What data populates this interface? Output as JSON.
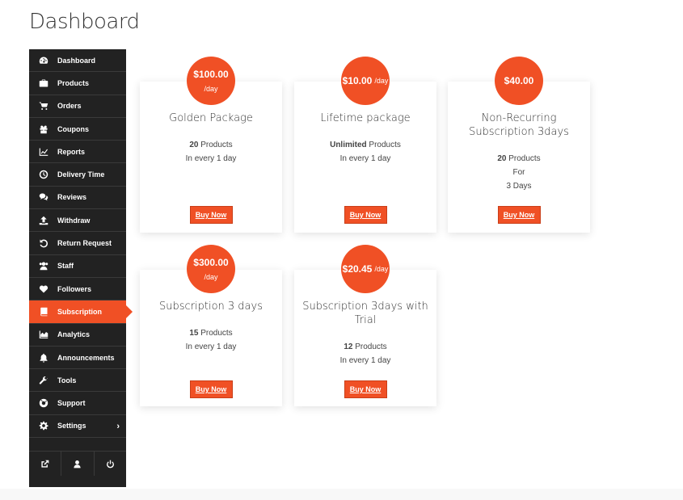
{
  "page": {
    "title": "Dashboard"
  },
  "sidebar": {
    "items": [
      {
        "label": "Dashboard",
        "icon": "dashboard-icon"
      },
      {
        "label": "Products",
        "icon": "briefcase-icon"
      },
      {
        "label": "Orders",
        "icon": "cart-icon"
      },
      {
        "label": "Coupons",
        "icon": "gift-icon"
      },
      {
        "label": "Reports",
        "icon": "chart-line-icon"
      },
      {
        "label": "Delivery Time",
        "icon": "clock-icon"
      },
      {
        "label": "Reviews",
        "icon": "comments-icon"
      },
      {
        "label": "Withdraw",
        "icon": "upload-icon"
      },
      {
        "label": "Return Request",
        "icon": "undo-icon"
      },
      {
        "label": "Staff",
        "icon": "users-icon"
      },
      {
        "label": "Followers",
        "icon": "heart-icon"
      },
      {
        "label": "Subscription",
        "icon": "book-icon",
        "active": true
      },
      {
        "label": "Analytics",
        "icon": "area-chart-icon"
      },
      {
        "label": "Announcements",
        "icon": "bell-icon"
      },
      {
        "label": "Tools",
        "icon": "wrench-icon"
      },
      {
        "label": "Support",
        "icon": "lifebuoy-icon"
      },
      {
        "label": "Settings",
        "icon": "gear-icon",
        "has_submenu": true,
        "chevron": "›"
      }
    ],
    "bottom_buttons": [
      {
        "icon": "external-link-icon"
      },
      {
        "icon": "user-icon"
      },
      {
        "icon": "power-icon"
      }
    ]
  },
  "packages": [
    {
      "price": "$100.00",
      "period": "/day",
      "title": "Golden Package",
      "product_count": "20",
      "product_suffix": " Products",
      "interval": "In every 1 day",
      "button": "Buy Now"
    },
    {
      "price": "$10.00",
      "period": "/day",
      "title": "Lifetime package",
      "product_count": "Unlimited",
      "product_suffix": " Products",
      "interval": "In every 1 day",
      "button": "Buy Now"
    },
    {
      "price": "$40.00",
      "period": "",
      "title_line1": "Non-Recurring",
      "title_line2": "Subscription 3days",
      "product_count": "20",
      "product_suffix": " Products",
      "for_label": "For",
      "duration": "3 Days",
      "button": "Buy Now"
    },
    {
      "price": "$300.00",
      "period": "/day",
      "title": "Subscription 3 days",
      "product_count": "15",
      "product_suffix": " Products",
      "interval": "In every 1 day",
      "button": "Buy Now"
    },
    {
      "price": "$20.45",
      "period": "/day",
      "title_line1": "Subscription 3days with",
      "title_line2": "Trial",
      "product_count": "12",
      "product_suffix": " Products",
      "interval": "In every 1 day",
      "button": "Buy Now"
    }
  ],
  "colors": {
    "accent": "#f05025",
    "sidebar_bg": "#222222"
  }
}
